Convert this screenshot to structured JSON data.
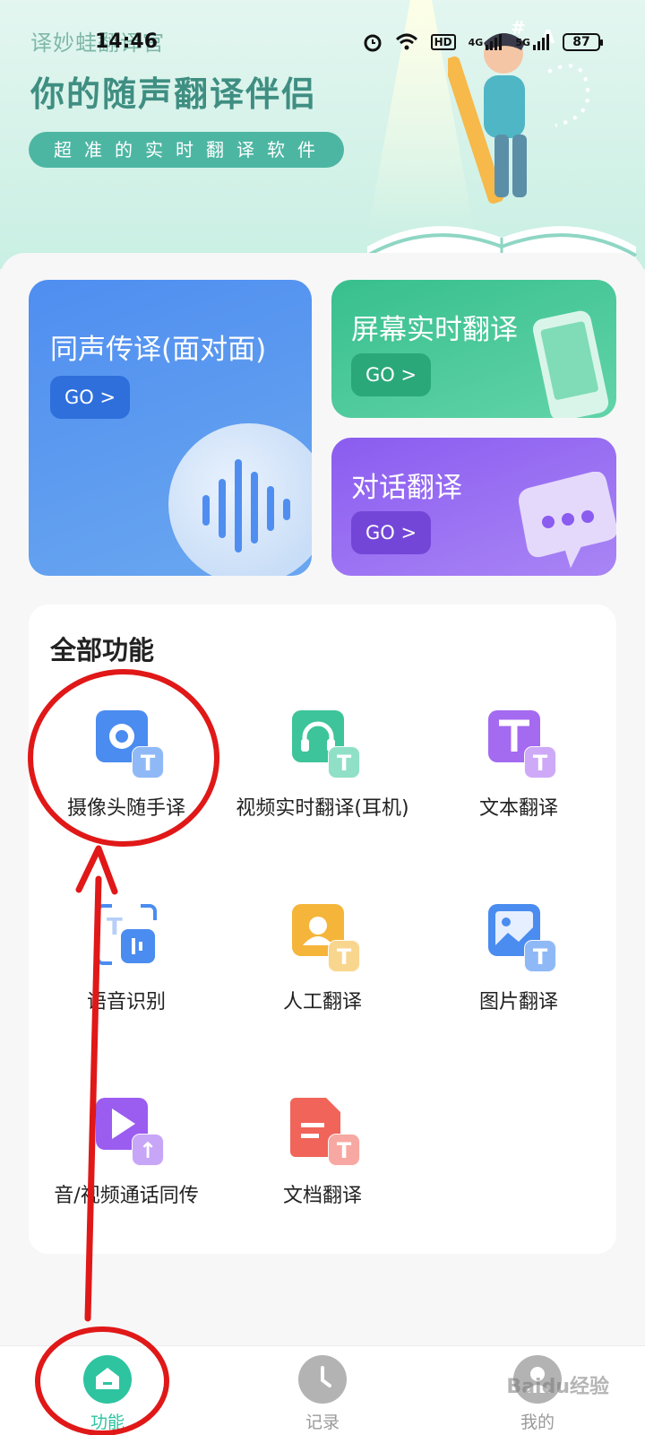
{
  "status_bar": {
    "time": "14:46",
    "battery": "87",
    "network_1": "4G",
    "network_2": "5G",
    "hd": "HD"
  },
  "banner": {
    "app_name": "译妙蛙翻译官",
    "slogan": "你的随声翻译伴侣",
    "tagline": "超准的实时翻译软件"
  },
  "cards": {
    "simultaneous": {
      "title": "同声传译(面对面)",
      "go": "GO >"
    },
    "screen": {
      "title": "屏幕实时翻译",
      "go": "GO >"
    },
    "dialog": {
      "title": "对话翻译",
      "go": "GO >"
    }
  },
  "features": {
    "title": "全部功能",
    "items": [
      {
        "label": "摄像头随手译",
        "icon": "camera-translate-icon",
        "color": "#4a8cf0"
      },
      {
        "label": "视频实时翻译(耳机)",
        "icon": "headphone-translate-icon",
        "color": "#3dc49a"
      },
      {
        "label": "文本翻译",
        "icon": "text-translate-icon",
        "color": "#a46af0"
      },
      {
        "label": "语音识别",
        "icon": "voice-recognition-icon",
        "color": "#4a8cf0"
      },
      {
        "label": "人工翻译",
        "icon": "human-translate-icon",
        "color": "#f5b53b"
      },
      {
        "label": "图片翻译",
        "icon": "image-translate-icon",
        "color": "#4a8cf0"
      },
      {
        "label": "音/视频通话同传",
        "icon": "call-translate-icon",
        "color": "#9b5cf0"
      },
      {
        "label": "文档翻译",
        "icon": "document-translate-icon",
        "color": "#f0645a"
      }
    ]
  },
  "bottom_nav": {
    "items": [
      {
        "label": "功能",
        "icon": "home-icon",
        "active": true
      },
      {
        "label": "记录",
        "icon": "clock-icon",
        "active": false
      },
      {
        "label": "我的",
        "icon": "profile-icon",
        "active": false
      }
    ]
  },
  "watermark": "Baidu经验",
  "colors": {
    "accent": "#2ec4a0",
    "annotation_red": "#e01818",
    "inactive": "#9a9a9a"
  }
}
